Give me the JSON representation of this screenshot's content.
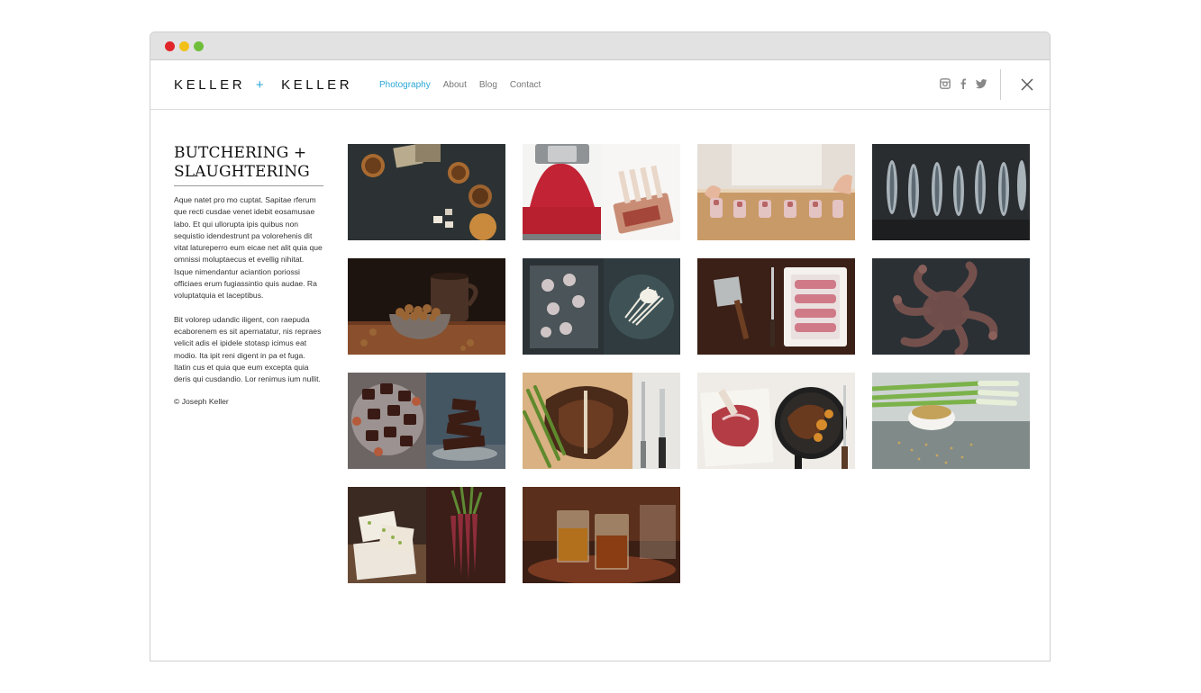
{
  "header": {
    "logo_left": "KELLER",
    "logo_plus": "+",
    "logo_right": "KELLER",
    "nav": [
      {
        "label": "Photography",
        "active": true
      },
      {
        "label": "About",
        "active": false
      },
      {
        "label": "Blog",
        "active": false
      },
      {
        "label": "Contact",
        "active": false
      }
    ],
    "social_icons": [
      "instagram-icon",
      "facebook-icon",
      "twitter-icon"
    ],
    "close_icon": "close-icon",
    "accent_color": "#2aa7d6"
  },
  "window": {
    "traffic_lights": [
      "#e0262b",
      "#f2c117",
      "#6fbe3b"
    ]
  },
  "intro": {
    "title": "BUTCHERING +\nSLAUGHTERING",
    "paragraph_1": "Aque natet pro mo cuptat. Sapitae rferum que recti cusdae venet idebit eosamusae labo. Et qui ullorupta ipis quibus non sequistio idendestrunt pa volorehenis dit vitat latureperro eum eicae net alit quia que omnissi moluptaecus et evellig nihitat. Isque nimendantur aciantion poriossi officiaes erum fugiassintio quis audae. Ra voluptatquia et laceptibus.",
    "paragraph_2": "Bit volorep udandic iligent, con raepuda ecaborenem es sit apernatatur, nis repraes velicit adis el ipidele stotasp icimus eat modio. Ita ipit reni digent in pa et fuga. Itatin cus et quia que eum excepta quia deris qui cusdandio. Lor renimus ium nullit.",
    "copyright": "© Joseph Keller"
  },
  "gallery": {
    "photos": [
      {
        "subject": "tea-cups-and-sugar"
      },
      {
        "subject": "meat-grinder-and-rack-of-lamb"
      },
      {
        "subject": "butcher-cutting-bone-marrow"
      },
      {
        "subject": "sardines-on-slate"
      },
      {
        "subject": "bowl-of-hazelnuts-and-mug"
      },
      {
        "subject": "baby-octopus-and-enoki"
      },
      {
        "subject": "cleaver-and-ribs"
      },
      {
        "subject": "octopus-on-dark-board"
      },
      {
        "subject": "chocolates-and-chocolate-stack"
      },
      {
        "subject": "t-bone-steak-with-knife-and-fork"
      },
      {
        "subject": "raw-steak-and-cast-iron-pan"
      },
      {
        "subject": "scallions-and-spices"
      },
      {
        "subject": "nougat-and-purple-carrots"
      },
      {
        "subject": "glasses-of-whiskey"
      }
    ]
  }
}
